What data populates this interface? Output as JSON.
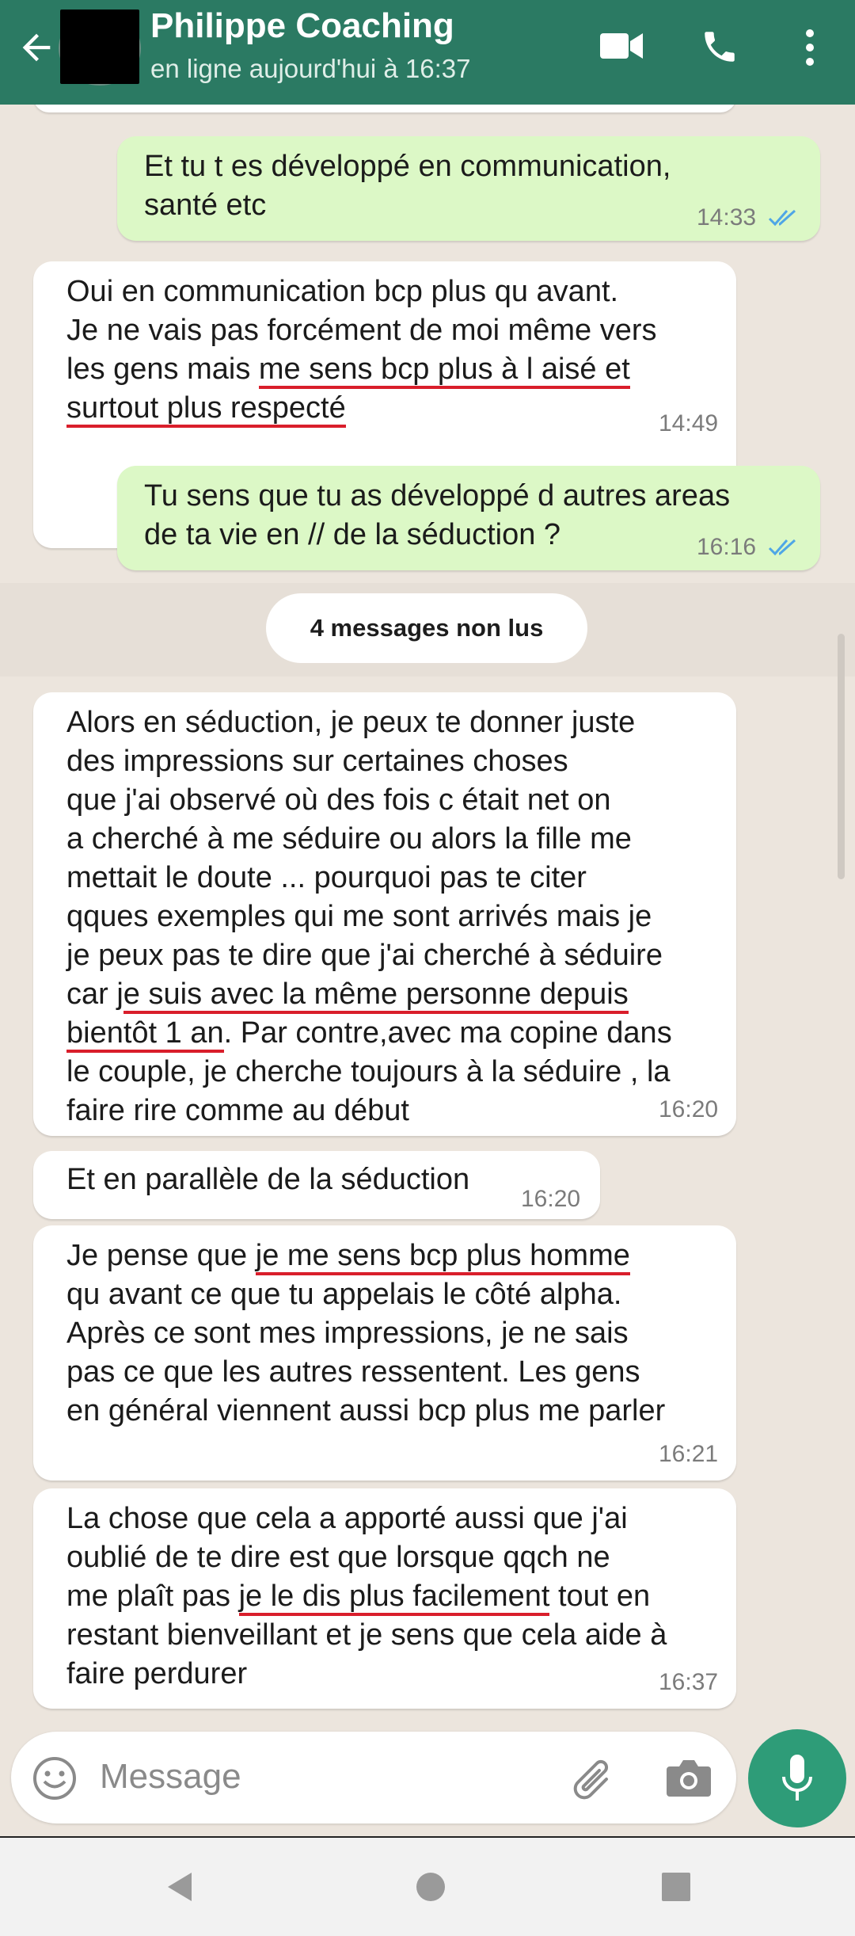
{
  "header": {
    "title": "Philippe Coaching",
    "status": "en ligne aujourd'hui à 16:37"
  },
  "messages": [
    {
      "id": "m1",
      "direction": "out",
      "line1": "Et tu t es développé en communication,",
      "line2": "santé etc",
      "time": "14:33",
      "ticks": "read"
    },
    {
      "id": "m2",
      "direction": "in",
      "line1": "Oui en communication bcp plus qu avant.",
      "line2": "Je ne vais pas forcément de moi même vers",
      "line3a": "les gens mais ",
      "line3b": "me sens bcp plus à l aisé et",
      "line4": "surtout plus respecté",
      "time": "14:49"
    },
    {
      "id": "m3",
      "direction": "out",
      "line1": "Tu sens que tu as développé d autres areas",
      "line2": "de ta vie en // de la séduction ?",
      "time": "16:16",
      "ticks": "read"
    },
    {
      "id": "m4",
      "direction": "in",
      "line1": "Alors en séduction, je peux te donner juste",
      "line2": "des impressions sur certaines choses",
      "line3": "que j'ai observé où des fois c était net on",
      "line4": "a cherché à me séduire ou alors la fille me",
      "line5": "mettait le doute ... pourquoi pas te citer",
      "line6": "qques exemples qui me sont arrivés mais je",
      "line7": "je peux pas te dire que j'ai cherché à séduire",
      "line8a": "car j",
      "line8b": "e suis avec la même personne depuis",
      "line9a": "bientôt 1 an",
      "line9b": ". Par contre,avec ma copine dans",
      "line10": "le couple, je cherche toujours à la séduire , la",
      "line11": "faire rire comme au début",
      "time": "16:20"
    },
    {
      "id": "m5",
      "direction": "in",
      "line1": "Et en parallèle de la séduction",
      "time": "16:20"
    },
    {
      "id": "m6",
      "direction": "in",
      "line1a": "Je pense que ",
      "line1b": "je me sens bcp plus homme",
      "line2": "qu avant ce que tu appelais le côté alpha.",
      "line3": "Après ce sont mes impressions, je ne sais",
      "line4": "pas ce que les autres ressentent. Les gens",
      "line5": "en général viennent aussi bcp plus me parler",
      "time": "16:21"
    },
    {
      "id": "m7",
      "direction": "in",
      "line1": "La chose que cela a apporté aussi que j'ai",
      "line2": "oublié de te dire est que lorsque qqch ne",
      "line3a": "me plaît pas ",
      "line3b": "je le dis plus facilement",
      "line3c": " tout en",
      "line4": "restant bienveillant et je sens que cela aide à",
      "line5": "faire perdurer",
      "time": "16:37"
    }
  ],
  "unread_label": "4 messages non lus",
  "composer": {
    "placeholder": "Message"
  },
  "icons": {
    "back": "back-arrow-icon",
    "video": "video-call-icon",
    "call": "phone-icon",
    "menu": "more-vert-icon",
    "emoji": "emoji-icon",
    "attach": "paperclip-icon",
    "camera": "camera-icon",
    "mic": "mic-icon",
    "nav_back": "nav-back-icon",
    "nav_home": "nav-home-icon",
    "nav_recents": "nav-recents-icon"
  },
  "colors": {
    "header": "#2b7a63",
    "outgoing": "#dcf8c6",
    "incoming": "#ffffff",
    "background": "#ece5dd",
    "accent": "#2e9c78",
    "underline": "#d91e2b",
    "read_ticks": "#4fa6e6"
  }
}
